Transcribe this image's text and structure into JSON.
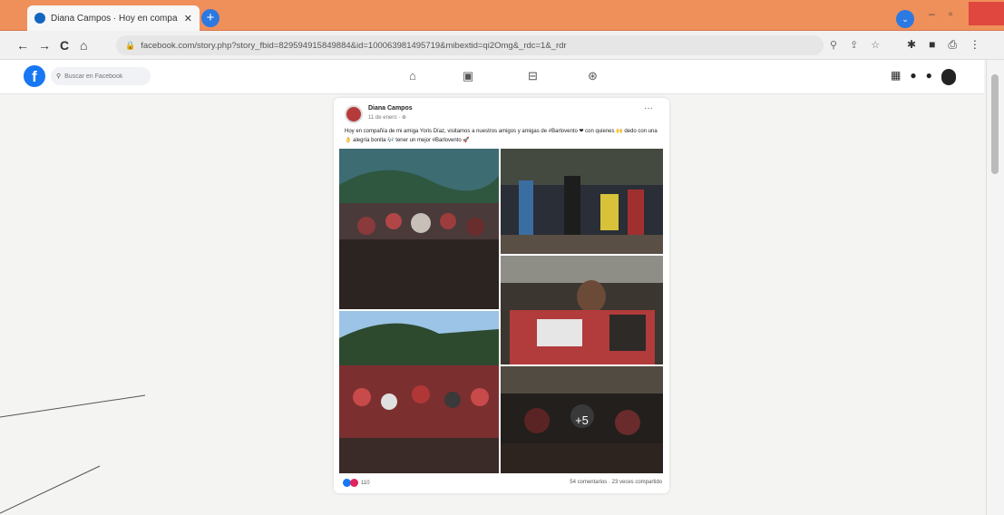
{
  "browser": {
    "tab_title": "Diana Campos · Hoy en compa",
    "tab_close": "✕",
    "newtab": "+",
    "url": "facebook.com/story.php?story_fbid=829594915849884&id=100063981495719&mibextid=qi2Omg&_rdc=1&_rdr",
    "nav": {
      "back": "←",
      "forward": "→",
      "reload": "C",
      "home": "⌂"
    },
    "window": {
      "minimize": "–",
      "maximize": "▫"
    }
  },
  "facebook": {
    "logo": "f",
    "search_placeholder": "Buscar en Facebook",
    "nav_icons": [
      "home-icon",
      "watch-icon",
      "marketplace-icon",
      "groups-icon"
    ]
  },
  "post": {
    "author": "Diana Campos",
    "date": "11 de enero · ⊕",
    "more": "···",
    "text": "Hoy en compañía de mi amiga Yoris Díaz, visitamos a nuestros amigos y amigas de #Barlovento ❤ con quienes 🙌 dedo con una 👌 alegría bonita 🎶 tener un mejor #Barlovento 🚀",
    "more_photos": "+5",
    "reaction_count": "110",
    "comments_shares": "54 comentarios · 23 veces compartido"
  },
  "colors": {
    "titlebar": "#ef8f5a",
    "fb_blue": "#1877f2",
    "close_red": "#e0473f"
  }
}
